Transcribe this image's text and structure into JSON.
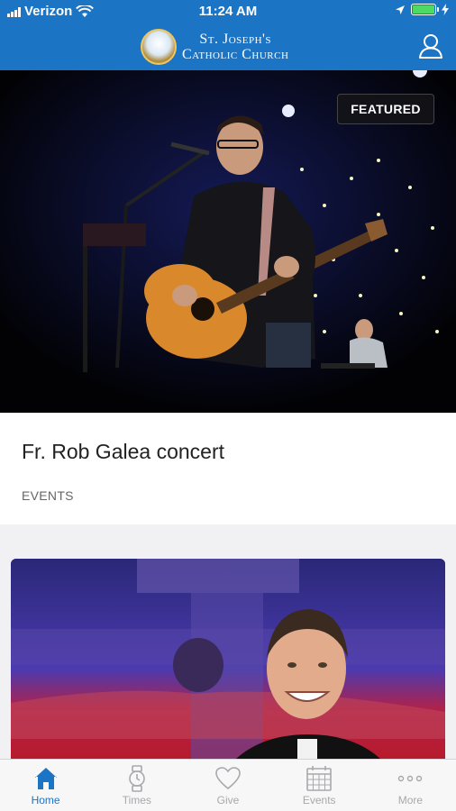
{
  "status_bar": {
    "carrier": "Verizon",
    "time": "11:24 AM"
  },
  "header": {
    "title_line1": "St. Joseph's",
    "title_line2": "Catholic Church",
    "icons": [
      "church-logo",
      "user-icon"
    ]
  },
  "featured": {
    "badge": "FEATURED",
    "title": "Fr. Rob Galea concert",
    "category": "EVENTS"
  },
  "tabs": [
    {
      "label": "Home",
      "icon": "home-icon",
      "active": true
    },
    {
      "label": "Times",
      "icon": "watch-icon",
      "active": false
    },
    {
      "label": "Give",
      "icon": "heart-icon",
      "active": false
    },
    {
      "label": "Events",
      "icon": "calendar-icon",
      "active": false
    },
    {
      "label": "More",
      "icon": "more-dots-icon",
      "active": false
    }
  ],
  "colors": {
    "primary": "#1c74c4",
    "tab_inactive": "#a8a8ac"
  }
}
